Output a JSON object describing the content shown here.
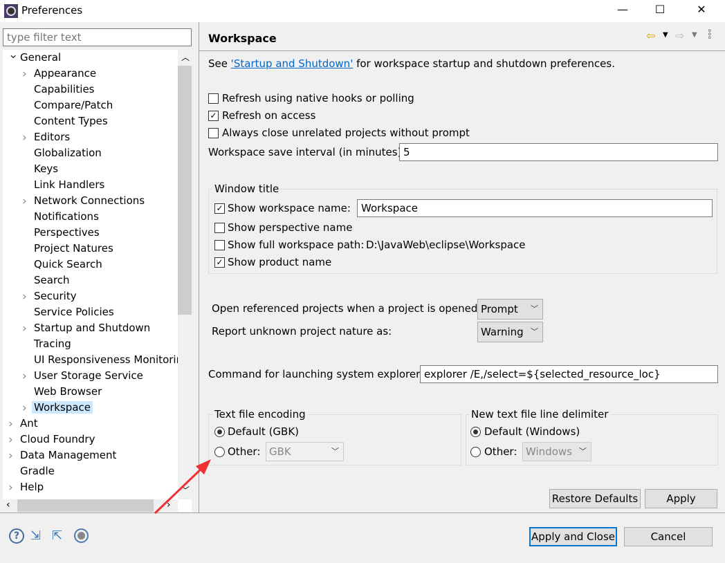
{
  "window": {
    "title": "Preferences",
    "minimize": "—",
    "maximize": "☐",
    "close": "✕"
  },
  "sidebar": {
    "filter_placeholder": "type filter text",
    "items": [
      {
        "label": "General",
        "level": 0,
        "expanded": true
      },
      {
        "label": "Appearance",
        "level": 1,
        "has_children": true
      },
      {
        "label": "Capabilities",
        "level": 1
      },
      {
        "label": "Compare/Patch",
        "level": 1
      },
      {
        "label": "Content Types",
        "level": 1
      },
      {
        "label": "Editors",
        "level": 1,
        "has_children": true
      },
      {
        "label": "Globalization",
        "level": 1
      },
      {
        "label": "Keys",
        "level": 1
      },
      {
        "label": "Link Handlers",
        "level": 1
      },
      {
        "label": "Network Connections",
        "level": 1,
        "has_children": true
      },
      {
        "label": "Notifications",
        "level": 1
      },
      {
        "label": "Perspectives",
        "level": 1
      },
      {
        "label": "Project Natures",
        "level": 1
      },
      {
        "label": "Quick Search",
        "level": 1
      },
      {
        "label": "Search",
        "level": 1
      },
      {
        "label": "Security",
        "level": 1,
        "has_children": true
      },
      {
        "label": "Service Policies",
        "level": 1
      },
      {
        "label": "Startup and Shutdown",
        "level": 1,
        "has_children": true
      },
      {
        "label": "Tracing",
        "level": 1
      },
      {
        "label": "UI Responsiveness Monitorir",
        "level": 1
      },
      {
        "label": "User Storage Service",
        "level": 1,
        "has_children": true
      },
      {
        "label": "Web Browser",
        "level": 1
      },
      {
        "label": "Workspace",
        "level": 1,
        "has_children": true,
        "selected": true
      },
      {
        "label": "Ant",
        "level": 0,
        "has_children": true
      },
      {
        "label": "Cloud Foundry",
        "level": 0,
        "has_children": true
      },
      {
        "label": "Data Management",
        "level": 0,
        "has_children": true
      },
      {
        "label": "Gradle",
        "level": 0
      },
      {
        "label": "Help",
        "level": 0,
        "has_children": true
      }
    ]
  },
  "page": {
    "title": "Workspace",
    "intro_before": "See ",
    "intro_link": "'Startup and Shutdown'",
    "intro_after": " for workspace startup and shutdown preferences.",
    "refresh_native": {
      "label": "Refresh using native hooks or polling",
      "checked": false
    },
    "refresh_access": {
      "label": "Refresh on access",
      "checked": true
    },
    "always_close": {
      "label": "Always close unrelated projects without prompt",
      "checked": false
    },
    "save_interval_label": "Workspace save interval (in minutes):",
    "save_interval_value": "5",
    "window_title": {
      "legend": "Window title",
      "show_ws_name": {
        "label": "Show workspace name:",
        "checked": true,
        "value": "Workspace"
      },
      "show_perspective": {
        "label": "Show perspective name",
        "checked": false
      },
      "show_full_path": {
        "label": "Show full workspace path:",
        "checked": false,
        "value": "D:\\JavaWeb\\eclipse\\Workspace"
      },
      "show_product": {
        "label": "Show product name",
        "checked": true
      }
    },
    "open_ref_label": "Open referenced projects when a project is opened:",
    "open_ref_value": "Prompt",
    "report_label": "Report unknown project nature as:",
    "report_value": "Warning",
    "cmd_label": "Command for launching system explorer:",
    "cmd_value": "explorer /E,/select=${selected_resource_loc}",
    "encoding": {
      "legend": "Text file encoding",
      "default": "Default (GBK)",
      "other": "Other:",
      "other_value": "GBK",
      "selected": "default"
    },
    "delimiter": {
      "legend": "New text file line delimiter",
      "default": "Default (Windows)",
      "other": "Other:",
      "other_value": "Windows",
      "selected": "default"
    },
    "restore_defaults": "Restore Defaults",
    "apply": "Apply"
  },
  "footer": {
    "apply_close": "Apply and Close",
    "cancel": "Cancel"
  },
  "colors": {
    "selection": "#cce8ff",
    "link": "#0066cc",
    "default_button_border": "#0078d7",
    "annotation_arrow": "#f03030"
  }
}
